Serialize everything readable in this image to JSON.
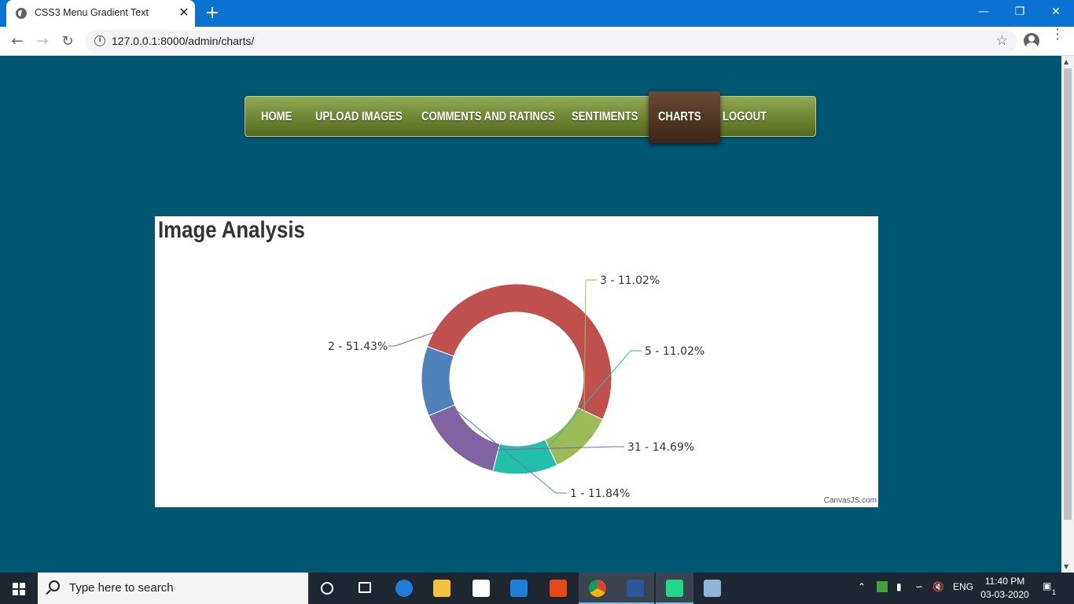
{
  "browser": {
    "tab_title": "CSS3 Menu Gradient Text",
    "tab_close": "✕",
    "new_tab": "+",
    "url": "127.0.0.1:8000/admin/charts/",
    "window_minimize": "—",
    "window_restore": "❐",
    "window_close": "✕"
  },
  "nav": {
    "items": [
      "HOME",
      "UPLOAD IMAGES",
      "COMMENTS AND RATINGS",
      "SENTIMENTS",
      "CHARTS",
      "LOGOUT"
    ],
    "active": "CHARTS"
  },
  "chart_data": {
    "type": "pie",
    "subtype": "doughnut",
    "title": "Image Analysis",
    "credit": "CanvasJS.com",
    "slices": [
      {
        "label": "2",
        "percent": 51.43,
        "text": "2 - 51.43%",
        "color": "#c0504e"
      },
      {
        "label": "3",
        "percent": 11.02,
        "text": "3 - 11.02%",
        "color": "#9bbb58"
      },
      {
        "label": "5",
        "percent": 11.02,
        "text": "5 - 11.02%",
        "color": "#23bfaa"
      },
      {
        "label": "31",
        "percent": 14.69,
        "text": "31 - 14.69%",
        "color": "#8064a1"
      },
      {
        "label": "1",
        "percent": 11.84,
        "text": "1 - 11.84%",
        "color": "#4f81bc"
      }
    ]
  },
  "taskbar": {
    "search_placeholder": "Type here to search",
    "language": "ENG",
    "time": "11:40 PM",
    "date": "03-03-2020",
    "notification_count": "1"
  },
  "colors": {
    "page_bg": "#015672",
    "menu_green": "#6e8434",
    "menu_active_brown": "#4e3322",
    "titlebar_blue": "#0a72d0"
  }
}
